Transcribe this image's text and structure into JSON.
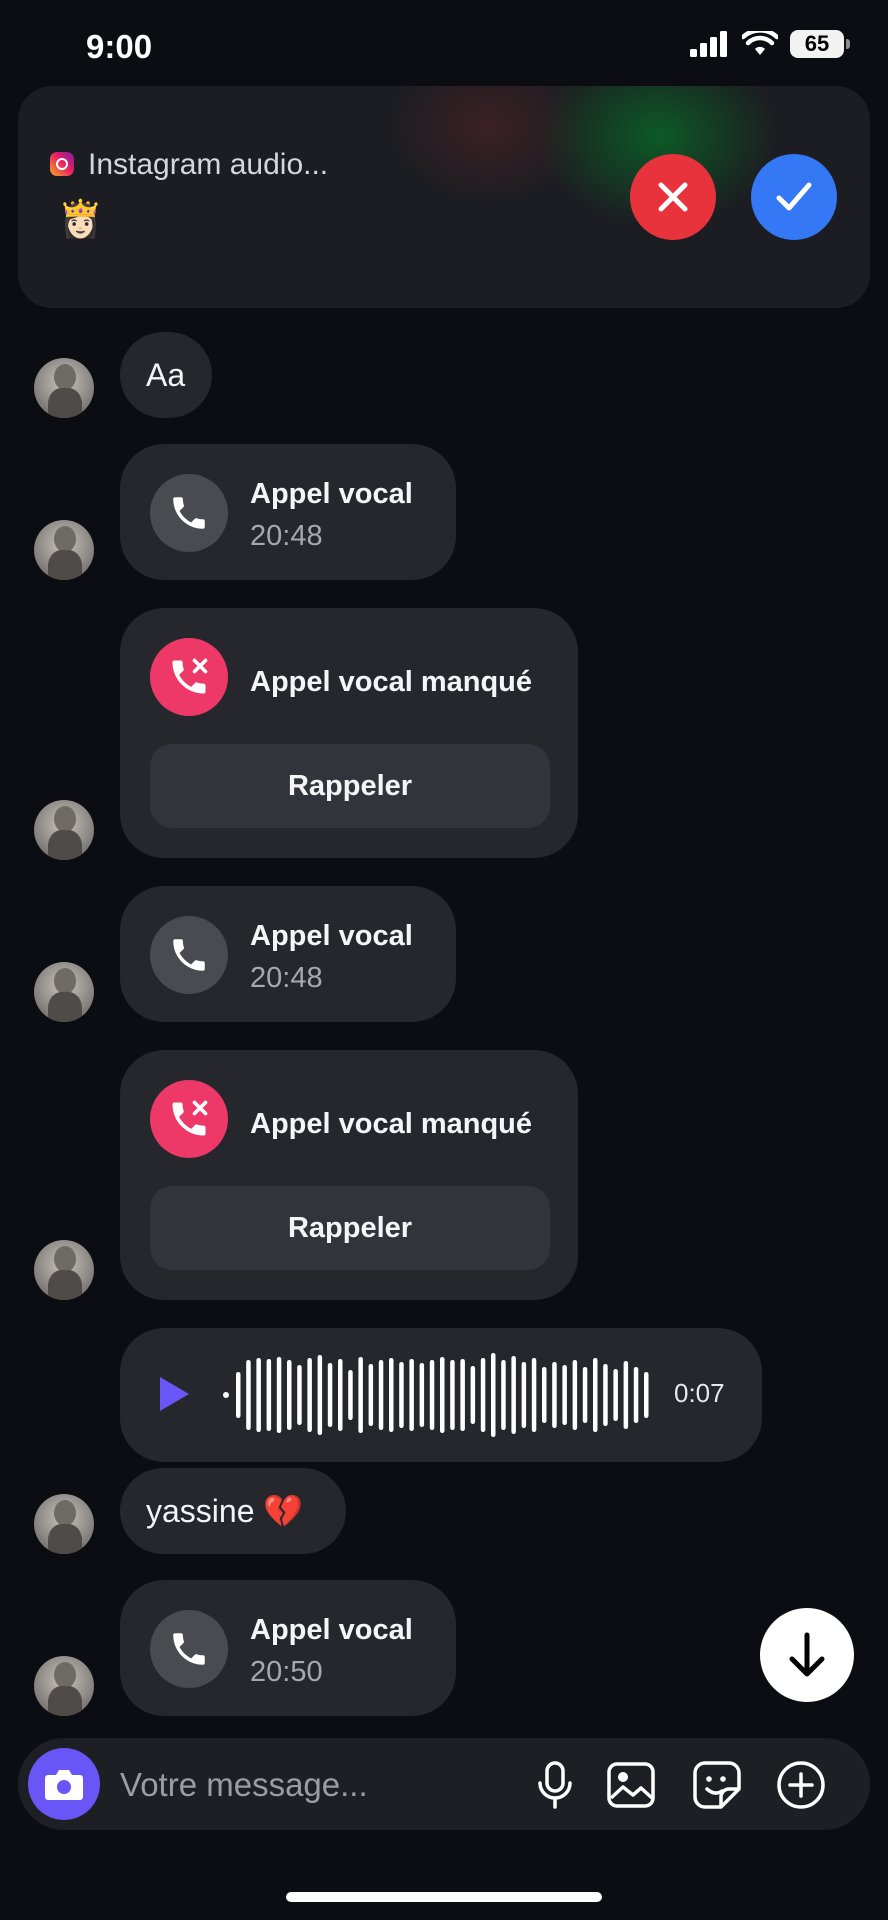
{
  "status_bar": {
    "time": "9:00",
    "battery": "65"
  },
  "call_banner": {
    "title": "Instagram audio...",
    "emoji": "👸🏻"
  },
  "messages": [
    {
      "type": "text",
      "text": "Aa"
    },
    {
      "type": "call",
      "title": "Appel vocal",
      "time": "20:48"
    },
    {
      "type": "missed",
      "title": "Appel vocal manqué",
      "action": "Rappeler"
    },
    {
      "type": "call",
      "title": "Appel vocal",
      "time": "20:48"
    },
    {
      "type": "missed",
      "title": "Appel vocal manqué",
      "action": "Rappeler"
    },
    {
      "type": "voice",
      "duration": "0:07"
    },
    {
      "type": "text",
      "text": "yassine 💔"
    },
    {
      "type": "call",
      "title": "Appel vocal",
      "time": "20:50"
    }
  ],
  "composer": {
    "placeholder": "Votre message..."
  },
  "colors": {
    "accent_purple": "#6a55f7",
    "decline_red": "#e8323c",
    "accept_blue": "#3478f6",
    "missed_pink": "#ee3867"
  }
}
